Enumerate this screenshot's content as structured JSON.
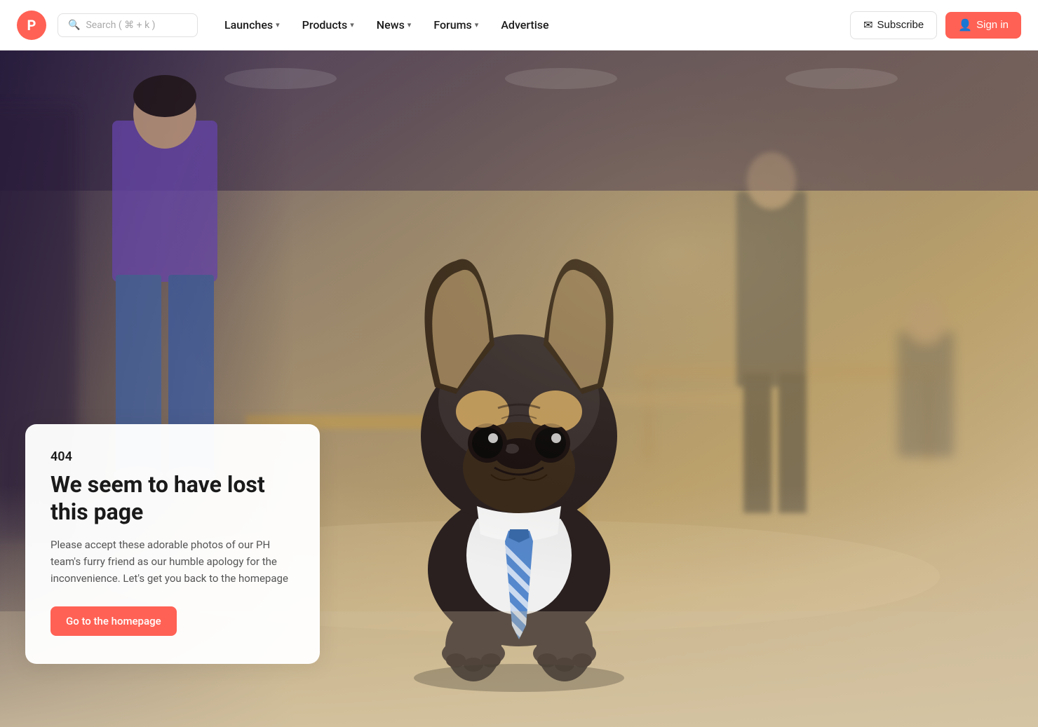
{
  "site": {
    "logo_letter": "P",
    "logo_color": "#ff6154"
  },
  "nav": {
    "search_placeholder": "Search ( ⌘ + k )",
    "links": [
      {
        "id": "launches",
        "label": "Launches",
        "has_dropdown": true
      },
      {
        "id": "products",
        "label": "Products",
        "has_dropdown": true
      },
      {
        "id": "news",
        "label": "News",
        "has_dropdown": true
      },
      {
        "id": "forums",
        "label": "Forums",
        "has_dropdown": true
      },
      {
        "id": "advertise",
        "label": "Advertise",
        "has_dropdown": false
      }
    ],
    "subscribe_label": "Subscribe",
    "signin_label": "Sign in"
  },
  "error": {
    "code": "404",
    "title": "We seem to have lost this page",
    "description": "Please accept these adorable photos of our PH team's furry friend as our humble apology for the inconvenience. Let's get you back to the homepage",
    "cta_label": "Go to the homepage"
  },
  "colors": {
    "brand": "#ff6154",
    "text_dark": "#1a1a1a",
    "text_muted": "#555555"
  }
}
